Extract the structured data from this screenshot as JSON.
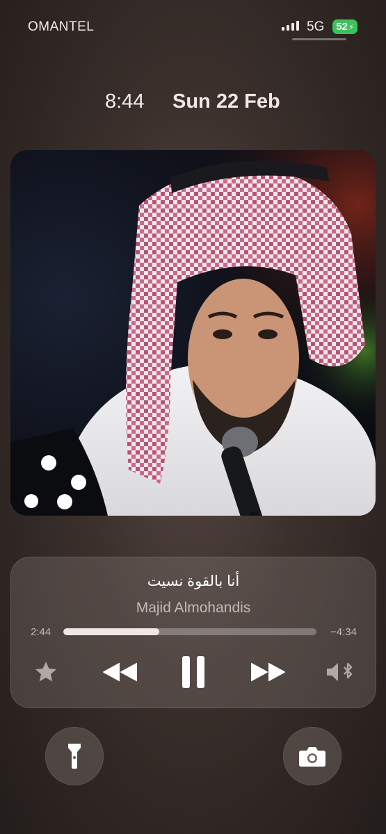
{
  "status_bar": {
    "carrier": "OMANTEL",
    "network": "5G",
    "battery": "52",
    "battery_color": "#3bc25a",
    "signal_icon": "signal-bars-icon"
  },
  "lock_screen": {
    "time": "8:44",
    "date": "Sun 22 Feb"
  },
  "artwork": {
    "icon": "album-artwork"
  },
  "now_playing": {
    "title": "أنا بالقوة نسيت",
    "artist": "Majid Almohandis",
    "elapsed": "2:44",
    "remaining": "−4:34",
    "progress_fraction": 0.38,
    "controls": {
      "favorite_icon": "star-icon",
      "rewind_icon": "rewind-icon",
      "pause_icon": "pause-icon",
      "forward_icon": "fast-forward-icon",
      "output_icon": "speaker-bluetooth-icon"
    }
  },
  "bottom_actions": {
    "left_icon": "flashlight-icon",
    "right_icon": "camera-icon"
  }
}
